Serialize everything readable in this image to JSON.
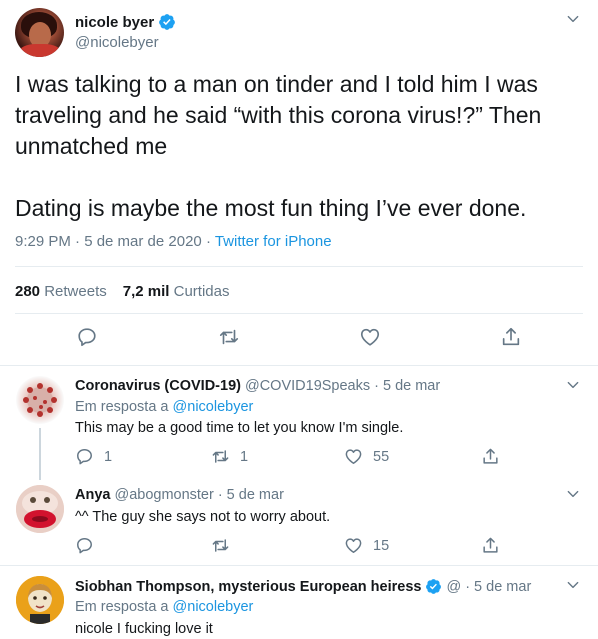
{
  "tweet": {
    "display_name": "nicole byer",
    "handle": "@nicolebyer",
    "text": "I was talking to a man on tinder and I told him I was traveling and he said “with this corona virus!?” Then unmatched me\n\nDating is maybe the most fun thing I’ve ever done.",
    "time": "9:29 PM · 5 de mar de 2020 · ",
    "source": "Twitter for iPhone",
    "retweets_count": "280",
    "retweets_label": "Retweets",
    "likes_count": "7,2 mil",
    "likes_label": "Curtidas"
  },
  "replies": [
    {
      "display_name": "Coronavirus (COVID-19)",
      "handle": "@COVID19Speaks",
      "date": "· 5 de mar",
      "replying_prefix": "Em resposta a",
      "replying_to": "@nicolebyer",
      "text": "This may be a good time to let you know I'm single.",
      "replies": "1",
      "retweets": "1",
      "likes": "55"
    },
    {
      "display_name": "Anya",
      "handle": "@abogmonster",
      "date": "· 5 de mar",
      "text": "^^ The guy she says not to worry about.",
      "replies": "",
      "retweets": "",
      "likes": "15"
    },
    {
      "display_name": "Siobhan Thompson, mysterious European heiress",
      "handle": "@",
      "date": "· 5 de mar",
      "replying_prefix": "Em resposta a",
      "replying_to": "@nicolebyer",
      "text": "nicole I fucking love it"
    }
  ],
  "colors": {
    "accent": "#1b95e0",
    "muted": "#657786",
    "text": "#14171a",
    "border": "#e6ecf0"
  },
  "icons": [
    "verified-badge-icon",
    "chevron-down-icon",
    "reply-icon",
    "retweet-icon",
    "like-icon",
    "share-icon"
  ]
}
